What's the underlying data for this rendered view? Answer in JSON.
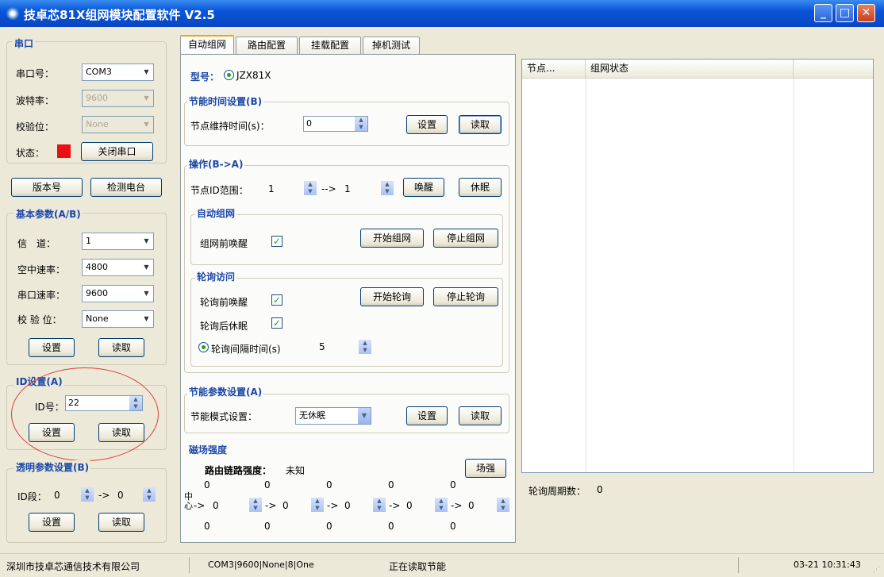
{
  "window": {
    "title": "技卓芯81X组网模块配置软件 V2.5",
    "minimize": "_",
    "maximize": "□",
    "close": "✕"
  },
  "serial": {
    "group_title": "串口",
    "port_label": "串口号：",
    "port_value": "COM3",
    "baud_label": "波特率：",
    "baud_value": "9600",
    "parity_label": "校验位：",
    "parity_value": "None",
    "status_label": "状态：",
    "status_color": "#e81010",
    "close_port": "关闭串口"
  },
  "buttons": {
    "version": "版本号",
    "detect": "检测电台"
  },
  "basic": {
    "group_title": "基本参数(A/B)",
    "channel_label": "信　道：",
    "channel_value": "1",
    "air_rate_label": "空中速率：",
    "air_rate_value": "4800",
    "serial_rate_label": "串口速率：",
    "serial_rate_value": "9600",
    "parity_label": "校 验 位：",
    "parity_value": "None",
    "set": "设置",
    "read": "读取"
  },
  "id_settings": {
    "group_title": "ID设置(A)",
    "id_label": "ID号：",
    "id_value": "22",
    "set": "设置",
    "read": "读取"
  },
  "transparent": {
    "group_title": "透明参数设置(B)",
    "id_range_label": "ID段：",
    "from": "0",
    "arrow": "->",
    "to": "0",
    "set": "设置",
    "read": "读取"
  },
  "tabs": [
    "自动组网",
    "路由配置",
    "挂载配置",
    "掉机测试"
  ],
  "auto_network": {
    "model_label": "型号：",
    "model_value": "JZX81X",
    "energy_time": {
      "group_title": "节能时间设置(B)",
      "hold_label": "节点维持时间(s)：",
      "hold_value": "0",
      "set": "设置",
      "read": "读取"
    },
    "operation": {
      "group_title": "操作(B->A)",
      "range_label": "节点ID范围：",
      "range_from": "1",
      "arrow": "-->",
      "range_to": "1",
      "wake": "唤醒",
      "sleep": "休眠",
      "auto": {
        "group_title": "自动组网",
        "wake_before": "组网前唤醒",
        "start": "开始组网",
        "stop": "停止组网"
      },
      "poll": {
        "group_title": "轮询访问",
        "wake_before": "轮询前唤醒",
        "sleep_after": "轮询后休眠",
        "interval_label": "轮询间隔时间(s)",
        "interval_value": "5",
        "start": "开始轮询",
        "stop": "停止轮询"
      }
    },
    "energy_params": {
      "group_title": "节能参数设置(A)",
      "mode_label": "节能模式设置：",
      "mode_value": "无休眠",
      "set": "设置",
      "read": "读取"
    },
    "field": {
      "group_title": "磁场强度",
      "route_label": "路由链路强度：",
      "route_value": "未知",
      "button": "场强",
      "center_label": "中心",
      "top_values": [
        "0",
        "0",
        "0",
        "0",
        "0"
      ],
      "arrow": "->",
      "hop_values": [
        "0",
        "0",
        "0",
        "0",
        "0"
      ],
      "bottom_values": [
        "0",
        "0",
        "0",
        "0",
        "0"
      ]
    }
  },
  "node_list": {
    "columns": [
      "节点...",
      "组网状态"
    ],
    "poll_count_label": "轮询周期数：",
    "poll_count_value": "0"
  },
  "statusbar": {
    "company": "深圳市技卓芯通信技术有限公司",
    "port_info": "COM3|9600|None|8|One",
    "message": "正在读取节能",
    "time": "03-21 10:31:43"
  }
}
